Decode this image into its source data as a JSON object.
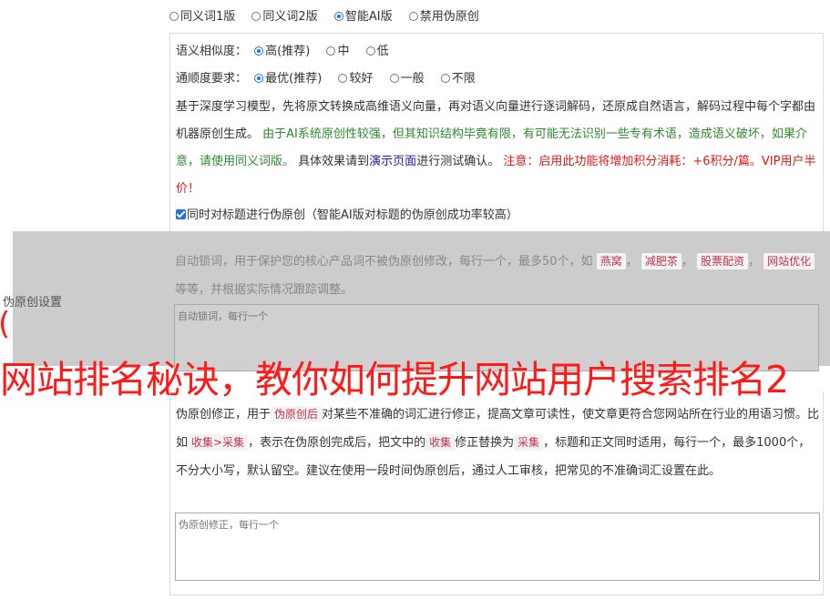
{
  "version_options": [
    {
      "label": "同义词1版",
      "checked": false
    },
    {
      "label": "同义词2版",
      "checked": false
    },
    {
      "label": "智能AI版",
      "checked": true
    },
    {
      "label": "禁用伪原创",
      "checked": false
    }
  ],
  "similarity": {
    "label": "语义相似度：",
    "options": [
      {
        "label": "高(推荐)",
        "checked": true
      },
      {
        "label": "中",
        "checked": false
      },
      {
        "label": "低",
        "checked": false
      }
    ]
  },
  "fluency": {
    "label": "通顺度要求：",
    "options": [
      {
        "label": "最优(推荐)",
        "checked": true
      },
      {
        "label": "较好",
        "checked": false
      },
      {
        "label": "一般",
        "checked": false
      },
      {
        "label": "不限",
        "checked": false
      }
    ]
  },
  "description": {
    "intro": "基于深度学习模型，先将原文转换成高维语义向量，再对语义向量进行逐词解码，还原成自然语言，解码过程中每个字都由机器原创生成。",
    "warning_green": "由于AI系统原创性较强，但其知识结构毕竟有限，有可能无法识别一些专有术语，造成语义破坏，如果介意，请使用同义词版。",
    "test_prefix": "具体效果请到",
    "demo_link": "演示页面",
    "test_suffix": "进行测试确认。",
    "cost_red": "注意：启用此功能将增加积分消耗：+6积分/篇。VIP用户半价！"
  },
  "title_check": {
    "label": "同时对标题进行伪原创（智能AI版对标题的伪原创成功率较高）",
    "checked": true
  },
  "settings_label": "伪原创设置",
  "lock_words": {
    "text_prefix": "自动锁词，用于保护您的核心产品词不被伪原创修改，每行一个，最多50个，如",
    "examples": [
      "燕窝",
      "减肥茶",
      "股票配资",
      "网站优化"
    ],
    "text_suffix": "等等，并根据实际情况跟踪调整。",
    "placeholder": "自动锁词，每行一个"
  },
  "overlay": {
    "paren": "(",
    "title": "网站排名秘诀，教你如何提升网站用户搜索排名2"
  },
  "correction": {
    "p1": "伪原创修正，用于",
    "tag1": "伪原创后",
    "p2": "对某些不准确的词汇进行修正，提高文章可读性，使文章更符合您网站所在行业的用语习惯。比如",
    "tag2": "收集>采集",
    "p3": "，表示在伪原创完成后，把文中的",
    "tag3": "收集",
    "p4": "修正替换为",
    "tag4": "采集",
    "p5": "，标题和正文同时适用，每行一个，最多1000个，不分大小写，默认留空。建议在使用一段时间伪原创后，通过人工审核，把常见的不准确词汇设置在此。",
    "placeholder": "伪原创修正，每行一个"
  }
}
